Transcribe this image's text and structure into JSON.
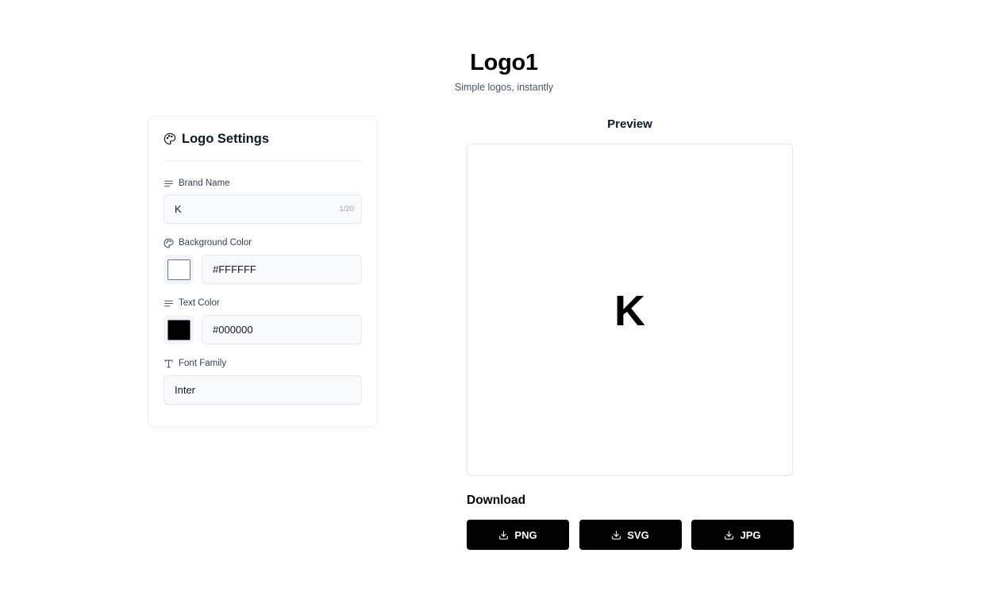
{
  "header": {
    "title": "Logo1",
    "subtitle": "Simple logos, instantly"
  },
  "settings": {
    "title": "Logo Settings",
    "title_icon": "palette-icon",
    "brand_name": {
      "label": "Brand Name",
      "icon": "text-lines-icon",
      "value": "K",
      "counter": "1/20"
    },
    "background_color": {
      "label": "Background Color",
      "icon": "palette-icon",
      "value": "#FFFFFF",
      "swatch": "#FFFFFF"
    },
    "text_color": {
      "label": "Text Color",
      "icon": "text-lines-icon",
      "value": "#000000",
      "swatch": "#000000"
    },
    "font_family": {
      "label": "Font Family",
      "icon": "type-icon",
      "value": "Inter"
    }
  },
  "preview": {
    "title": "Preview",
    "text": "K",
    "background": "#FFFFFF",
    "text_color": "#000000"
  },
  "download": {
    "title": "Download",
    "buttons": [
      {
        "label": "PNG",
        "icon": "download-icon"
      },
      {
        "label": "SVG",
        "icon": "download-icon"
      },
      {
        "label": "JPG",
        "icon": "download-icon"
      }
    ]
  }
}
